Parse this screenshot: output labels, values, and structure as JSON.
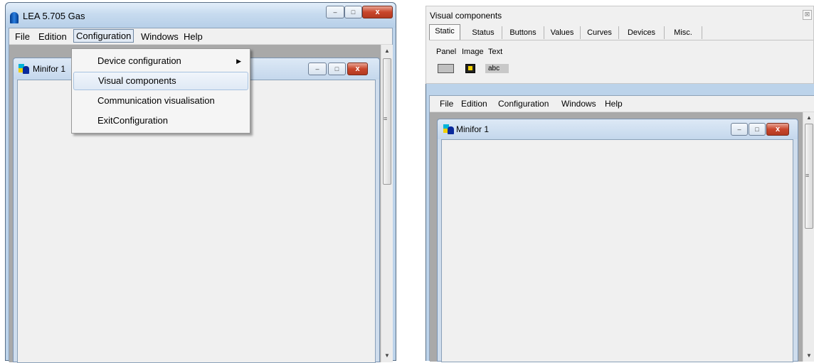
{
  "left": {
    "title": "LEA 5.705 Gas",
    "menu": [
      "File",
      "Edition",
      "Configuration",
      "Windows",
      "Help"
    ],
    "child_title": "Minifor 1",
    "dropdown": [
      {
        "label": "Device configuration",
        "submenu": true
      },
      {
        "label": "Visual components",
        "highlighted": true
      },
      {
        "label": "Communication visualisation"
      },
      {
        "label": "ExitConfiguration"
      }
    ]
  },
  "right": {
    "panel_title": "Visual components",
    "tabs": [
      "Static",
      "Status",
      "Buttons",
      "Values",
      "Curves",
      "Devices",
      "Misc."
    ],
    "components": [
      "Panel",
      "Image",
      "Text"
    ],
    "text_sample": "abc",
    "menu": [
      "File",
      "Edition",
      "Configuration",
      "Windows",
      "Help"
    ],
    "child_title": "Minifor 1"
  },
  "caption_buttons": {
    "minimize": "–",
    "maximize": "□",
    "close": "x",
    "panel_close": "☒"
  },
  "scroll": {
    "up": "▲",
    "down": "▼",
    "grip": "≡"
  },
  "submenu_arrow": "▶",
  "colors": {
    "highlight_border": "#a8c3e0",
    "close_button": "#c9462c",
    "titlebar": "#c7dbef"
  }
}
